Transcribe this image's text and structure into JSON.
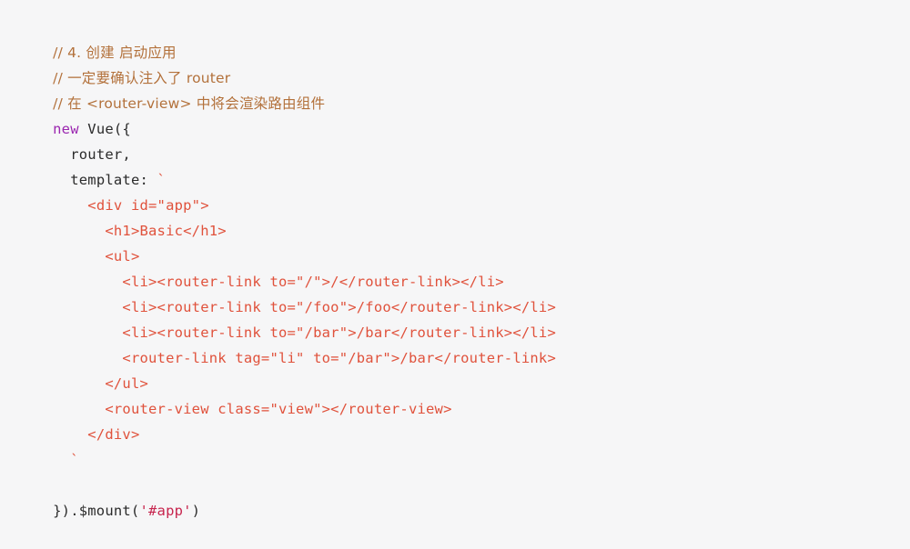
{
  "editor": {
    "language": "javascript",
    "background_color": "#f6f6f7",
    "default_text_color": "#2b2b2b",
    "comment_color": "#b3713b",
    "keyword_color": "#9b27b0",
    "template_string_color": "#e0523c",
    "string_literal_color": "#c7254e",
    "font_size_px": 15.5,
    "line_height_px": 28
  },
  "code": {
    "lines": [
      {
        "n": 1,
        "indent": "",
        "kind": "comment",
        "text": "// 4. 创建 启动应用"
      },
      {
        "n": 2,
        "indent": "",
        "kind": "comment",
        "text": "// 一定要确认注入了 router"
      },
      {
        "n": 3,
        "indent": "",
        "kind": "comment",
        "text": "// 在 <router-view> 中将会渲染路由组件"
      },
      {
        "n": 4,
        "indent": "",
        "kind": "keyword-line",
        "keyword": "new",
        "rest": " Vue({"
      },
      {
        "n": 5,
        "indent": "  ",
        "kind": "plain",
        "text": "router,"
      },
      {
        "n": 6,
        "indent": "  ",
        "kind": "template-open",
        "plain": "template: ",
        "backtick": "`"
      },
      {
        "n": 7,
        "indent": "    ",
        "kind": "template",
        "text": "<div id=\"app\">"
      },
      {
        "n": 8,
        "indent": "      ",
        "kind": "template",
        "text": "<h1>Basic</h1>"
      },
      {
        "n": 9,
        "indent": "      ",
        "kind": "template",
        "text": "<ul>"
      },
      {
        "n": 10,
        "indent": "        ",
        "kind": "template",
        "text": "<li><router-link to=\"/\">/</router-link></li>"
      },
      {
        "n": 11,
        "indent": "        ",
        "kind": "template",
        "text": "<li><router-link to=\"/foo\">/foo</router-link></li>"
      },
      {
        "n": 12,
        "indent": "        ",
        "kind": "template",
        "text": "<li><router-link to=\"/bar\">/bar</router-link></li>"
      },
      {
        "n": 13,
        "indent": "        ",
        "kind": "template",
        "text": "<router-link tag=\"li\" to=\"/bar\">/bar</router-link>"
      },
      {
        "n": 14,
        "indent": "      ",
        "kind": "template",
        "text": "</ul>"
      },
      {
        "n": 15,
        "indent": "      ",
        "kind": "template",
        "text": "<router-view class=\"view\"></router-view>"
      },
      {
        "n": 16,
        "indent": "    ",
        "kind": "template",
        "text": "</div>"
      },
      {
        "n": 17,
        "indent": "  ",
        "kind": "template",
        "text": "`"
      },
      {
        "n": 18,
        "indent": "",
        "kind": "blank",
        "text": " "
      },
      {
        "n": 19,
        "indent": "",
        "kind": "mount",
        "before": "}).$mount(",
        "string": "'#app'",
        "after": ")"
      }
    ]
  }
}
